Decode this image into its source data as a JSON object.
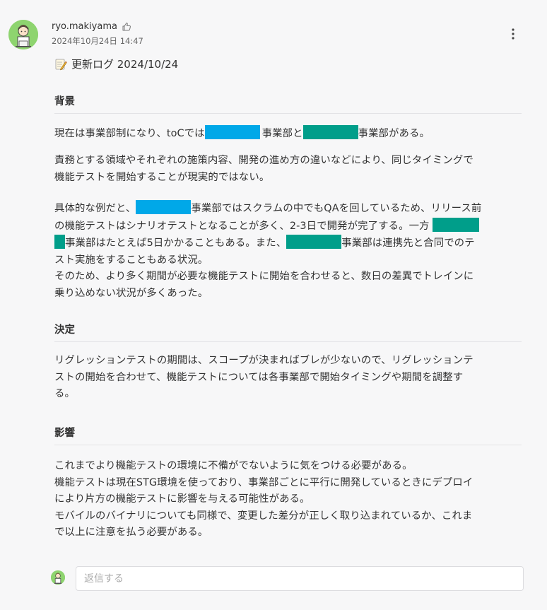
{
  "post": {
    "author": "ryo.makiyama",
    "timestamp": "2024年10月24日 14:47",
    "title": "更新ログ 2024/10/24",
    "icons": {
      "like": "thumbs-up-icon",
      "more": "more-vertical-icon",
      "title": "memo-icon"
    }
  },
  "sections": {
    "background": {
      "heading": "背景",
      "p1_a": "現在は事業部制になり、toCでは",
      "p1_b": "事業部と",
      "p1_c": "事業部がある。",
      "p2_l1": "責務とする領域やそれぞれの施策内容、開発の進め方の違いなどにより、同じタイミングで",
      "p2_l2": "機能テストを開始することが現実的ではない。",
      "p3_l1a": "具体的な例だと、",
      "p3_l1b": "事業部ではスクラムの中でもQAを回しているため、リリース前",
      "p3_l2": "の機能テストはシナリオテストとなることが多く、2-3日で開発が完了する。一方",
      "p3_l3a": "事業部はたとえば5日かかることもある。また、",
      "p3_l3b": "事業部は連携先と合同でのテ",
      "p3_l4": "スト実施をすることもある状況。",
      "p3_l5": "そのため、より多く期間が必要な機能テストに開始を合わせると、数日の差異でトレインに",
      "p3_l6": "乗り込めない状況が多くあった。"
    },
    "decision": {
      "heading": "決定",
      "l1": "リグレッションテストの期間は、スコープが決まればブレが少ないので、リグレッションテ",
      "l2": "ストの開始を合わせて、機能テストについては各事業部で開始タイミングや期間を調整す",
      "l3": "る。"
    },
    "impact": {
      "heading": "影響",
      "l1": "これまでより機能テストの環境に不備がでないように気をつける必要がある。",
      "l2": "機能テストは現在STG環境を使っており、事業部ごとに平行に開発しているときにデプロイ",
      "l3": "により片方の機能テストに影響を与える可能性がある。",
      "l4": "モバイルのバイナリについても同様で、変更した差分が正しく取り込まれているか、これま",
      "l5": "で以上に注意を払う必要がある。"
    }
  },
  "reply": {
    "placeholder": "返信する",
    "value": ""
  },
  "colors": {
    "redact_blue": "#00a8e8",
    "redact_teal": "#009e8a",
    "avatar_bg": "#8ed46f"
  }
}
